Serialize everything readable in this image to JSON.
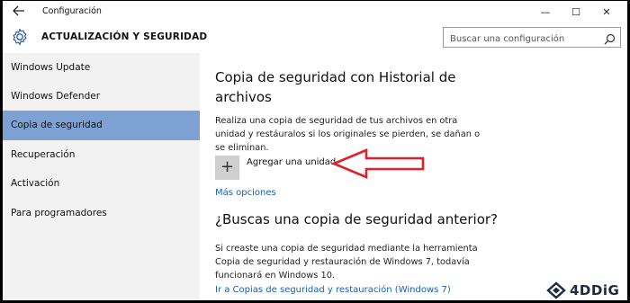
{
  "window": {
    "title": "Configuración",
    "controls": [
      "—",
      "☐",
      "✕"
    ]
  },
  "header": {
    "section_title": "ACTUALIZACIÓN Y SEGURIDAD",
    "search_placeholder": "Buscar una configuración"
  },
  "sidebar": {
    "items": [
      {
        "label": "Windows Update",
        "active": false
      },
      {
        "label": "Windows Defender",
        "active": false
      },
      {
        "label": "Copia de seguridad",
        "active": true
      },
      {
        "label": "Recuperación",
        "active": false
      },
      {
        "label": "Activación",
        "active": false
      },
      {
        "label": "Para programadores",
        "active": false
      }
    ]
  },
  "main": {
    "heading": "Copia de seguridad con Historial de archivos",
    "description": "Realiza una copia de seguridad de tus archivos en otra unidad y restáuralos si los originales se pierden, se dañan o se eliminan.",
    "add_drive_label": "Agregar una unidad",
    "more_options": "Más opciones",
    "heading2": "¿Buscas una copia de seguridad anterior?",
    "description2": "Si creaste una copia de seguridad mediante la herramienta Copia de seguridad y restauración de Windows 7, todavía funcionará en Windows 10.",
    "restore_link": "Ir a Copias de seguridad y restauración (Windows 7)"
  },
  "watermark": {
    "brand": "4DDiG"
  },
  "colors": {
    "active_nav": "#7ea1d4",
    "link": "#1a5fb4",
    "annotation_arrow": "#e0202a"
  }
}
